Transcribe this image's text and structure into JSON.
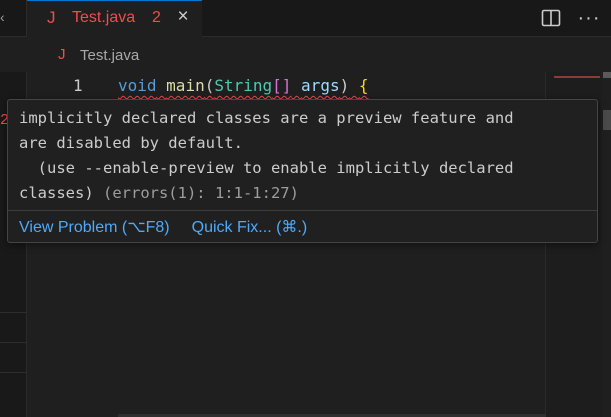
{
  "tab": {
    "icon_letter": "J",
    "label": "Test.java",
    "badge": "2",
    "close_glyph": "×",
    "stub_glyph": "‹"
  },
  "actions": {
    "split_icon": "split-editor-icon",
    "more_icon": "more-actions-icon",
    "more_glyph": "···"
  },
  "breadcrumb": {
    "icon_letter": "J",
    "label": "Test.java"
  },
  "left_panel": {
    "marker": "2"
  },
  "editor": {
    "line_number": "1",
    "tokens": {
      "kw": "void",
      "sp1": " ",
      "fn": "main",
      "paren_open": "(",
      "type": "String",
      "bracket": "[]",
      "sp2": " ",
      "param": "args",
      "paren_close": ")",
      "sp3": " ",
      "brace": "{"
    }
  },
  "hover": {
    "message_line1": "implicitly declared classes are a preview feature and",
    "message_line2": "are disabled by default.",
    "message_line3": "  (use --enable-preview to enable implicitly declared",
    "message_line4_text": "classes)",
    "message_line4_meta": " (errors(1): 1:1-1:27)",
    "view_problem": "View Problem (⌥F8)",
    "quick_fix": "Quick Fix... (⌘.)"
  },
  "colors": {
    "error": "#f14c4c",
    "link": "#4daafc",
    "active_tab_border": "#0078d4"
  }
}
